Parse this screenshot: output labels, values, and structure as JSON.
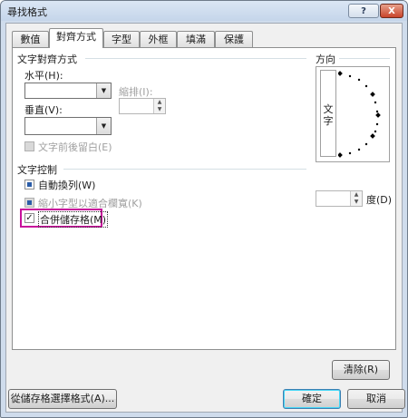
{
  "window": {
    "title": "尋找格式",
    "help_label": "?",
    "close_label": "X"
  },
  "tabs": [
    {
      "label": "數值",
      "active": false
    },
    {
      "label": "對齊方式",
      "active": true
    },
    {
      "label": "字型",
      "active": false
    },
    {
      "label": "外框",
      "active": false
    },
    {
      "label": "填滿",
      "active": false
    },
    {
      "label": "保護",
      "active": false
    }
  ],
  "alignment": {
    "group_title": "文字對齊方式",
    "horizontal_label": "水平(H):",
    "vertical_label": "垂直(V):",
    "indent_label": "縮排(I):",
    "horizontal_value": "",
    "vertical_value": "",
    "indent_value": "",
    "justify_distributed_label": "文字前後留白(E)"
  },
  "text_control": {
    "group_title": "文字控制",
    "wrap_text_label": "自動換列(W)",
    "shrink_to_fit_label": "縮小字型以適合欄寬(K)",
    "merge_cells_label": "合併儲存格(M)",
    "wrap_text_state": "indeterminate",
    "shrink_to_fit_state": "indeterminate",
    "merge_cells_checked": true
  },
  "orientation": {
    "group_title": "方向",
    "vertical_text": "文\n字",
    "degrees_label": "度(D)",
    "degrees_value": ""
  },
  "buttons": {
    "clear": "清除(R)",
    "choose_from_cell": "從儲存格選擇格式(A)...",
    "ok": "確定",
    "cancel": "取消"
  },
  "colors": {
    "highlight": "#c8109b",
    "accent": "#2b5da8"
  }
}
